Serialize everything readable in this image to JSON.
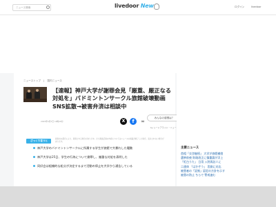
{
  "header": {
    "search_placeholder": "ニュース検索",
    "logo_main": "livedoor",
    "logo_news": "News",
    "login": "ログイン",
    "register": "livedoor"
  },
  "article": {
    "breadcrumbs": [
      "ニューストップ",
      "国内ニュース"
    ],
    "headline": "【速報】神戸大学が謝罪会見「厳重、厳正なる対処を」バドミントンサークル旅館破壊動画SNS拡散→被害弁済は相談中",
    "pubdate": "2025年4月7日 19時18分",
    "comment_button": "みんなの感想は？",
    "byline": "by シードアライド・ニュース提供"
  },
  "summary": {
    "badge": "ざっくり言うと",
    "note": "提供社の都合により、削除される場合があります。また関連記事の内容についてはニュースの掲載が終了した場合、表示されない場合があります。",
    "points": [
      "神戸大学のバドミントンサークルに所属する学生が旅館で大暴れした騒動",
      "神戸大学は25日、学生の行為について謝罪し、厳重な対処を表明した",
      "同好会は組織的な処分が決定するまで活動の停止を大学から通告している"
    ]
  },
  "sidebar": {
    "title": "主要ニュース",
    "items": [
      "首相「交渉継続」 大学が旅館補償",
      "選挙前夜 財政改正に慎重論が浮上",
      "「紅白うた」 日用 入院再訪人に",
      "二連休 「はかぞう」 悲劇に対応",
      "被害者の「証拠」認定の方針を示す",
      "被害の防止 ちらで 警戒進む"
    ]
  },
  "share": {
    "x_label": "X",
    "fb_label": "f",
    "link_label": "∞"
  }
}
